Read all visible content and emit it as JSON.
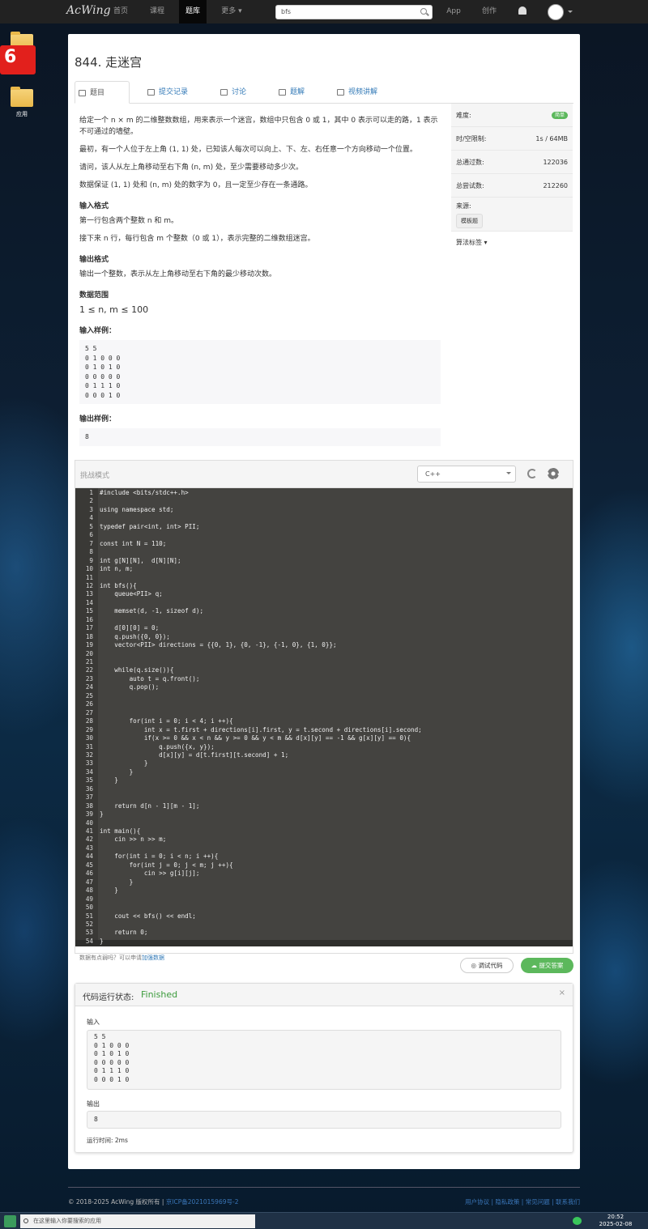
{
  "nav": {
    "logo": "AcWing",
    "items": [
      "首页",
      "课程",
      "题库",
      "更多 ▾",
      "App",
      "创作"
    ],
    "active": "题库",
    "search_value": "bfs"
  },
  "desktop": {
    "badge": "6",
    "folder_label": "应用"
  },
  "problem": {
    "title": "844. 走迷宫",
    "tabs": [
      "题目",
      "提交记录",
      "讨论",
      "题解",
      "视频讲解"
    ],
    "paragraphs": [
      "给定一个 n × m 的二维整数数组，用来表示一个迷宫，数组中只包含 0 或 1，其中 0 表示可以走的路，1 表示不可通过的墙壁。",
      "最初，有一个人位于左上角 (1, 1) 处，已知该人每次可以向上、下、左、右任意一个方向移动一个位置。",
      "请问，该人从左上角移动至右下角 (n, m) 处，至少需要移动多少次。",
      "数据保证 (1, 1) 处和 (n, m) 处的数字为 0，且一定至少存在一条通路。"
    ],
    "input_format_title": "输入格式",
    "input_format": [
      "第一行包含两个整数 n 和 m。",
      "接下来 n 行，每行包含 m 个整数（0 或 1），表示完整的二维数组迷宫。"
    ],
    "output_format_title": "输出格式",
    "output_format": "输出一个整数，表示从左上角移动至右下角的最少移动次数。",
    "range_title": "数据范围",
    "range": "1 ≤ n, m ≤ 100",
    "sample_in_title": "输入样例：",
    "sample_in": "5 5\n0 1 0 0 0\n0 1 0 1 0\n0 0 0 0 0\n0 1 1 1 0\n0 0 0 1 0",
    "sample_out_title": "输出样例：",
    "sample_out": "8"
  },
  "sidebar": {
    "difficulty_label": "难度:",
    "difficulty": "简单",
    "limit_label": "时/空限制:",
    "limit": "1s / 64MB",
    "passed_label": "总通过数:",
    "passed": "122036",
    "tried_label": "总尝试数:",
    "tried": "212260",
    "source_label": "来源:",
    "source": "模板题",
    "tags_label": "算法标签 ▾"
  },
  "editor": {
    "mode": "挑战模式",
    "language": "C++"
  },
  "actions": {
    "hint": "数据有点弱吗？可以申请",
    "hint_link": "加强数据",
    "debug": "调试代码",
    "submit": "提交答案"
  },
  "result": {
    "label": "代码运行状态:",
    "status": "Finished",
    "input_label": "输入",
    "input": "5 5\n0 1 0 0 0\n0 1 0 1 0\n0 0 0 0 0\n0 1 1 1 0\n0 0 0 1 0",
    "output_label": "输出",
    "output": "8",
    "time": "运行时间: 2ms"
  },
  "footer": {
    "copyright": "© 2018-2025 AcWing 版权所有 |",
    "icp": "京ICP备2021015969号-2",
    "links": "用户协议 | 隐私政策 | 常见问题 | 联系我们"
  },
  "taskbar": {
    "search_placeholder": "在这里输入你要搜索的应用",
    "time": "20:52",
    "date": "2025-02-08"
  },
  "code_lines": [
    "#include <bits/stdc++.h>",
    "",
    "using namespace std;",
    "",
    "typedef pair<int, int> PII;",
    "",
    "const int N = 110;",
    "",
    "int g[N][N],  d[N][N];",
    "int n, m;",
    "",
    "int bfs(){",
    "    queue<PII> q;",
    "",
    "    memset(d, -1, sizeof d);",
    "",
    "    d[0][0] = 0;",
    "    q.push({0, 0});",
    "    vector<PII> directions = {{0, 1}, {0, -1}, {-1, 0}, {1, 0}};",
    "",
    "",
    "    while(q.size()){",
    "        auto t = q.front();",
    "        q.pop();",
    "",
    "",
    "",
    "        for(int i = 0; i < 4; i ++){",
    "            int x = t.first + directions[i].first, y = t.second + directions[i].second;",
    "            if(x >= 0 && x < n && y >= 0 && y < m && d[x][y] == -1 && g[x][y] == 0){",
    "                q.push({x, y});",
    "                d[x][y] = d[t.first][t.second] + 1;",
    "            }",
    "        }",
    "    }",
    "",
    "",
    "    return d[n - 1][m - 1];",
    "}",
    "",
    "int main(){",
    "    cin >> n >> m;",
    "",
    "    for(int i = 0; i < n; i ++){",
    "        for(int j = 0; j < m; j ++){",
    "            cin >> g[i][j];",
    "        }",
    "    }",
    "",
    "",
    "    cout << bfs() << endl;",
    "",
    "    return 0;",
    "}"
  ]
}
